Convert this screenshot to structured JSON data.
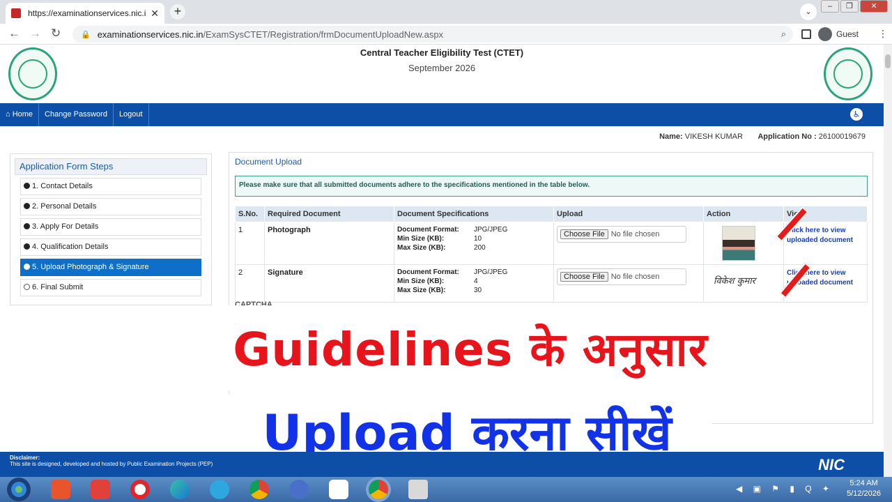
{
  "browser": {
    "tab_title": "https://examinationservices.nic.in",
    "url_host": "examinationservices.nic.in",
    "url_path": "/ExamSysCTET/Registration/frmDocumentUploadNew.aspx",
    "profile_label": "Guest"
  },
  "header": {
    "title": "Central Teacher Eligibility Test (CTET)",
    "subtitle": "September 2026"
  },
  "nav": {
    "home": "Home",
    "change_password": "Change Password",
    "logout": "Logout"
  },
  "user": {
    "name_label": "Name:",
    "name_value": "VIKESH KUMAR",
    "app_label": "Application No :",
    "app_value": "26100019679"
  },
  "steps": {
    "heading": "Application Form Steps",
    "items": [
      {
        "label": "1. Contact Details"
      },
      {
        "label": "2. Personal Details"
      },
      {
        "label": "3. Apply For Details"
      },
      {
        "label": "4. Qualification Details"
      },
      {
        "label": "5. Upload Photograph & Signature"
      },
      {
        "label": "6. Final Submit"
      }
    ]
  },
  "upload": {
    "heading": "Document Upload",
    "notice": "Please make sure that all submitted documents adhere to the specifications mentioned in the table below.",
    "columns": [
      "S.No.",
      "Required Document",
      "Document Specifications",
      "Upload",
      "Action",
      "View"
    ],
    "spec_labels": {
      "format": "Document Format:",
      "min": "Min Size (KB):",
      "max": "Max Size (KB):"
    },
    "choose_label": "Choose File",
    "no_file_label": "No file chosen",
    "view_link_line1": "Click here to view",
    "view_link_line2": "uploaded document",
    "rows": [
      {
        "sno": "1",
        "doc": "Photograph",
        "format": "JPG/JPEG",
        "min": "10",
        "max": "200"
      },
      {
        "sno": "2",
        "doc": "Signature",
        "format": "JPG/JPEG",
        "min": "4",
        "max": "30",
        "signature_text": "विकेश कुमार"
      }
    ],
    "captcha_fragment": "CAPTCHA"
  },
  "overlay": {
    "line1": "Guidelines के अनुसार",
    "line2": "Upload करना सीखें"
  },
  "footer": {
    "disclaimer_title": "Disclaimer:",
    "disclaimer_text": "This site is designed, developed and hosted by Public Examination Projects (PEP)",
    "nic_logo": "NIC"
  },
  "taskbar": {
    "time": "5:24 AM",
    "date": "5/12/2026"
  },
  "colors": {
    "brand_blue": "#0d4ea6",
    "overlay_red": "#e8141c",
    "overlay_blue": "#1232e8"
  }
}
